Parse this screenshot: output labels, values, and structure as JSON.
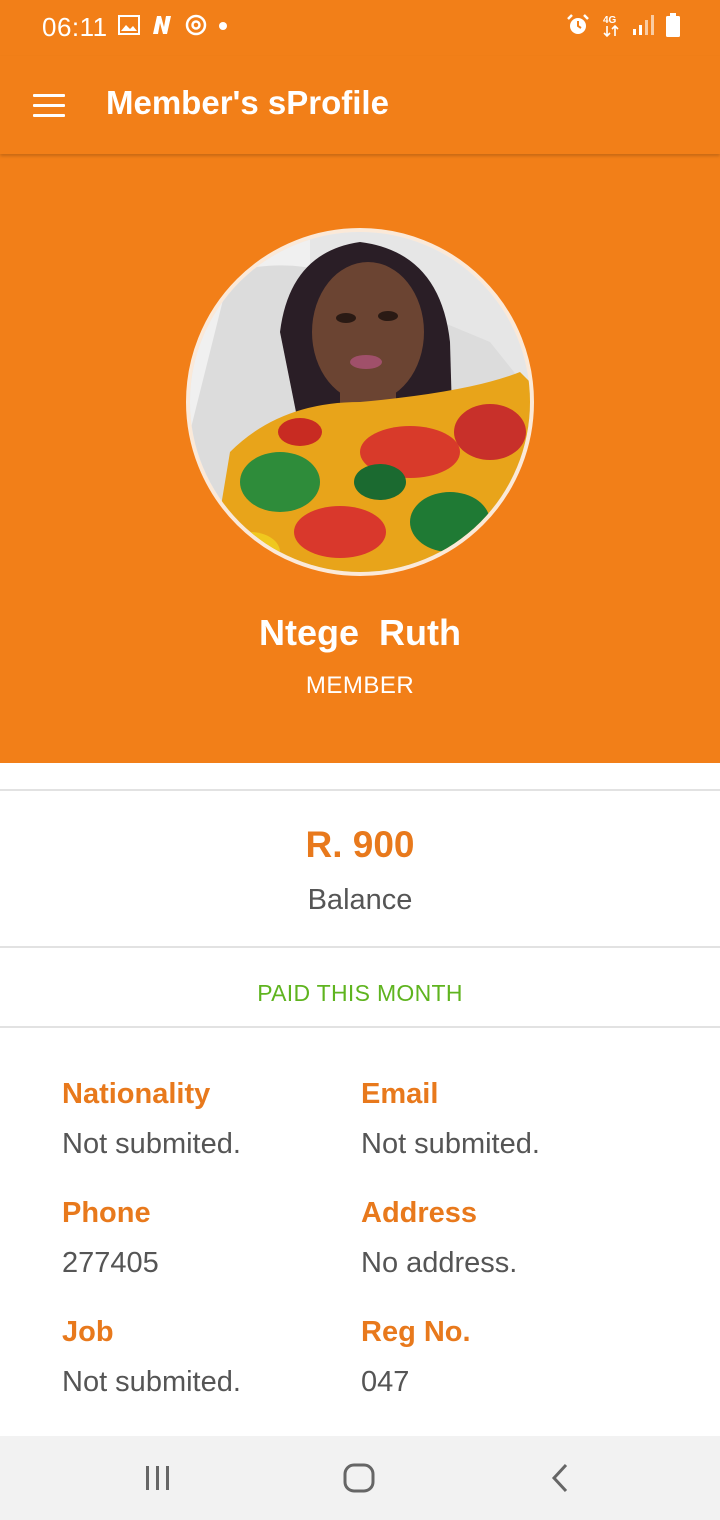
{
  "status_bar": {
    "time": "06:11",
    "icons_left": [
      "image-icon",
      "n-app-icon",
      "sync-icon",
      "dot-icon"
    ],
    "icons_right": [
      "alarm-icon",
      "4g-icon",
      "signal-icon",
      "battery-icon"
    ],
    "network": "4G"
  },
  "app_bar": {
    "title": "Member's sProfile",
    "menu_icon": "hamburger-menu-icon"
  },
  "profile": {
    "name": "Ntege  Ruth",
    "role": "MEMBER"
  },
  "balance": {
    "amount": "R. 900",
    "label": "Balance"
  },
  "payment_status": "PAID THIS MONTH",
  "details": [
    {
      "label": "Nationality",
      "value": "Not submited."
    },
    {
      "label": "Email",
      "value": "Not submited."
    },
    {
      "label": "Phone",
      "value": "277405"
    },
    {
      "label": "Address",
      "value": "No address."
    },
    {
      "label": "Job",
      "value": "Not submited."
    },
    {
      "label": "Reg No.",
      "value": "047"
    }
  ],
  "nav_bar": {
    "buttons": [
      "recent-apps-icon",
      "home-icon",
      "back-icon"
    ]
  },
  "colors": {
    "primary": "#f27f18",
    "accent_text": "#e8791c",
    "paid_green": "#5fb41f",
    "value_text": "#555555"
  }
}
